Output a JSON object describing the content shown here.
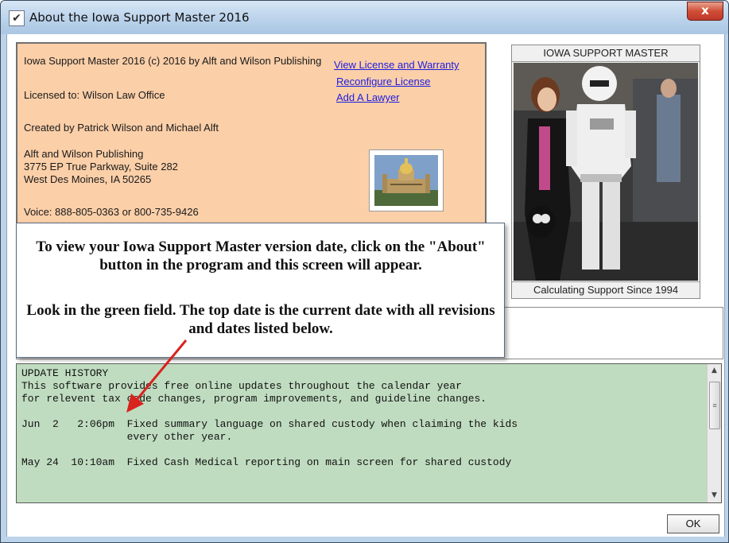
{
  "window": {
    "title": "About the Iowa Support Master 2016",
    "close_label": "x"
  },
  "info": {
    "line1": "Iowa Support Master 2016   (c) 2016 by Alft and Wilson Publishing",
    "licensed": "Licensed to:  Wilson Law Office",
    "created": "Created by Patrick Wilson and Michael Alft",
    "addr1": "Alft and Wilson Publishing",
    "addr2": "3775 EP True Parkway, Suite 282",
    "addr3": "West Des Moines, IA 50265",
    "voice": "Voice: 888-805-0363 or 800-735-9426",
    "links": {
      "license": "View License and Warranty",
      "reconfigure": "Reconfigure License",
      "lawyer": "Add A Lawyer"
    }
  },
  "photo_panel": {
    "title": "IOWA SUPPORT MASTER",
    "caption": "Calculating Support Since 1994"
  },
  "callout": {
    "paragraph1": "To view your Iowa Support Master version date, click on the \"About\" button in the program and this screen will appear.",
    "paragraph2": "Look in the green field. The top date is the current date with all revisions and dates listed below."
  },
  "history": {
    "text": "UPDATE HISTORY\nThis software provides free online updates throughout the calendar year\nfor relevent tax code changes, program improvements, and guideline changes.\n\nJun  2   2:06pm  Fixed summary language on shared custody when claiming the kids\n                 every other year.\n\nMay 24  10:10am  Fixed Cash Medical reporting on main screen for shared custody"
  },
  "buttons": {
    "ok": "OK"
  },
  "colors": {
    "info_bg": "#fbcfa8",
    "history_bg": "#c0dcc0",
    "link": "#1d1de0",
    "arrow": "#d8231f"
  }
}
